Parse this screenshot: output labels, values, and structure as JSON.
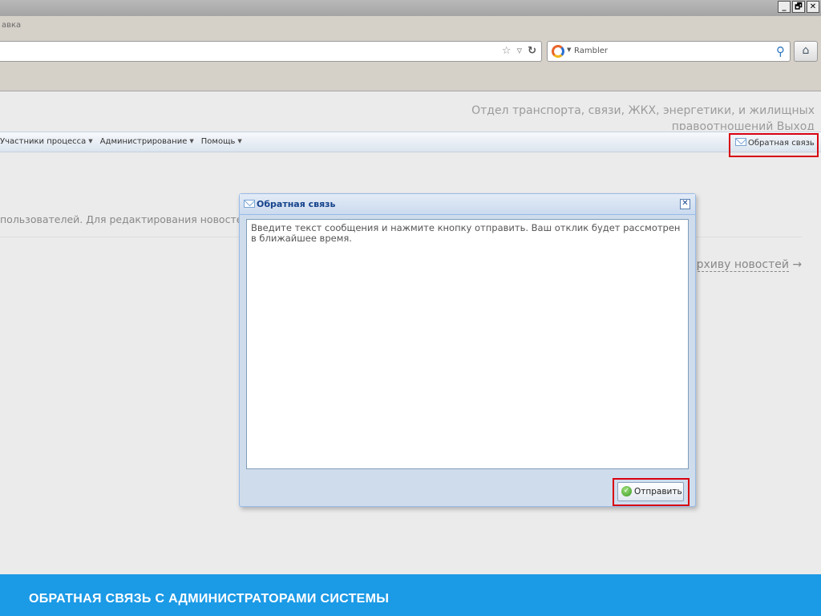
{
  "browser": {
    "window_buttons": [
      "_",
      "🗗",
      "✕"
    ],
    "menu_text": "авка",
    "search_engine": "Rambler",
    "icons": {
      "bookmark": "star-icon",
      "dropdown": "chevron-down-icon",
      "reload": "reload-icon",
      "search": "magnifier-icon",
      "home": "home-icon"
    }
  },
  "page": {
    "org_line1": "Отдел транспорта, связи, ЖКХ, энергетики, и жилищных",
    "org_line2": "правоотношений",
    "exit_label": "Выход",
    "menu_items": [
      "Участники процесса",
      "Администрирование",
      "Помощь"
    ],
    "feedback_label": "Обратная связь",
    "news_text": "пользователей. Для редактирования новостей н",
    "archive_link": "архиву новостей",
    "archive_arrow": "→"
  },
  "dialog": {
    "title": "Обратная связь",
    "close_symbol": "✕",
    "message": "Введите текст сообщения и нажмите кнопку отправить. Ваш отклик будет рассмотрен в ближайшее время.",
    "send_label": "Отправить"
  },
  "banner": {
    "title": "ОБРАТНАЯ СВЯЗЬ С АДМИНИСТРАТОРАМИ СИСТЕМЫ"
  },
  "colors": {
    "highlight": "#d8000f",
    "banner": "#1b9ae6",
    "dialog_title": "#15428b"
  }
}
